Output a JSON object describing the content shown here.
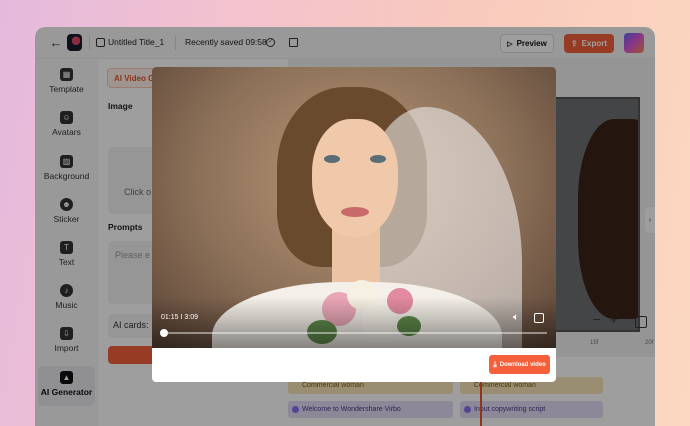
{
  "topbar": {
    "title": "Untitled Title_1",
    "saved_status": "Recently saved 09:58",
    "preview_label": "Preview",
    "export_label": "Export"
  },
  "sidebar": {
    "items": [
      {
        "label": "Template",
        "icon": "template-icon"
      },
      {
        "label": "Avatars",
        "icon": "avatars-icon"
      },
      {
        "label": "Background",
        "icon": "background-icon"
      },
      {
        "label": "Sticker",
        "icon": "sticker-icon"
      },
      {
        "label": "Text",
        "icon": "text-icon"
      },
      {
        "label": "Music",
        "icon": "music-icon"
      },
      {
        "label": "Import",
        "icon": "import-icon"
      },
      {
        "label": "AI Generator",
        "icon": "ai-generator-icon",
        "active": true
      }
    ]
  },
  "panel": {
    "chip_label": "AI Video G",
    "image_label": "Image",
    "image_placeholder": "Click o",
    "prompts_label": "Prompts",
    "prompt_placeholder": "Please e",
    "ai_cards_label": "AI cards:"
  },
  "timeline": {
    "ruler_ticks": [
      "15f",
      "20f"
    ],
    "clips": [
      {
        "label": "Commercial woman"
      },
      {
        "label": "Commercial woman"
      },
      {
        "label": "Welcome to Wondershare Virbo"
      },
      {
        "label": "Input copywriting script"
      }
    ]
  },
  "modal": {
    "current_time": "01:15",
    "total_time": "3:09",
    "time_separator": "I",
    "progress": 0.0,
    "download_label": "Download video"
  },
  "colors": {
    "accent": "#f5603a",
    "background_gradient": [
      "#e4b9dc",
      "#fcd8c0"
    ]
  }
}
